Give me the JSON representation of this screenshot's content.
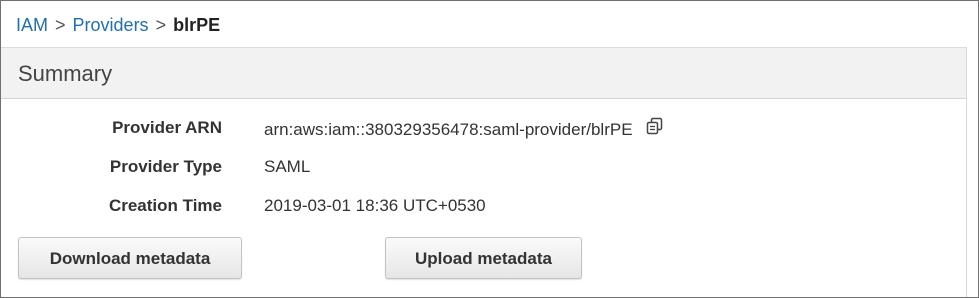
{
  "breadcrumb": {
    "items": [
      "IAM",
      "Providers"
    ],
    "separator": ">",
    "current": "blrPE"
  },
  "summary": {
    "title": "Summary",
    "fields": [
      {
        "label": "Provider ARN",
        "value": "arn:aws:iam::380329356478:saml-provider/blrPE"
      },
      {
        "label": "Provider Type",
        "value": "SAML"
      },
      {
        "label": "Creation Time",
        "value": "2019-03-01 18:36 UTC+0530"
      }
    ],
    "copy_icon": "copy-icon"
  },
  "actions": {
    "download_label": "Download metadata",
    "upload_label": "Upload metadata"
  },
  "colors": {
    "link": "#1f6fb2",
    "header_bg": "#f2f2f2"
  }
}
